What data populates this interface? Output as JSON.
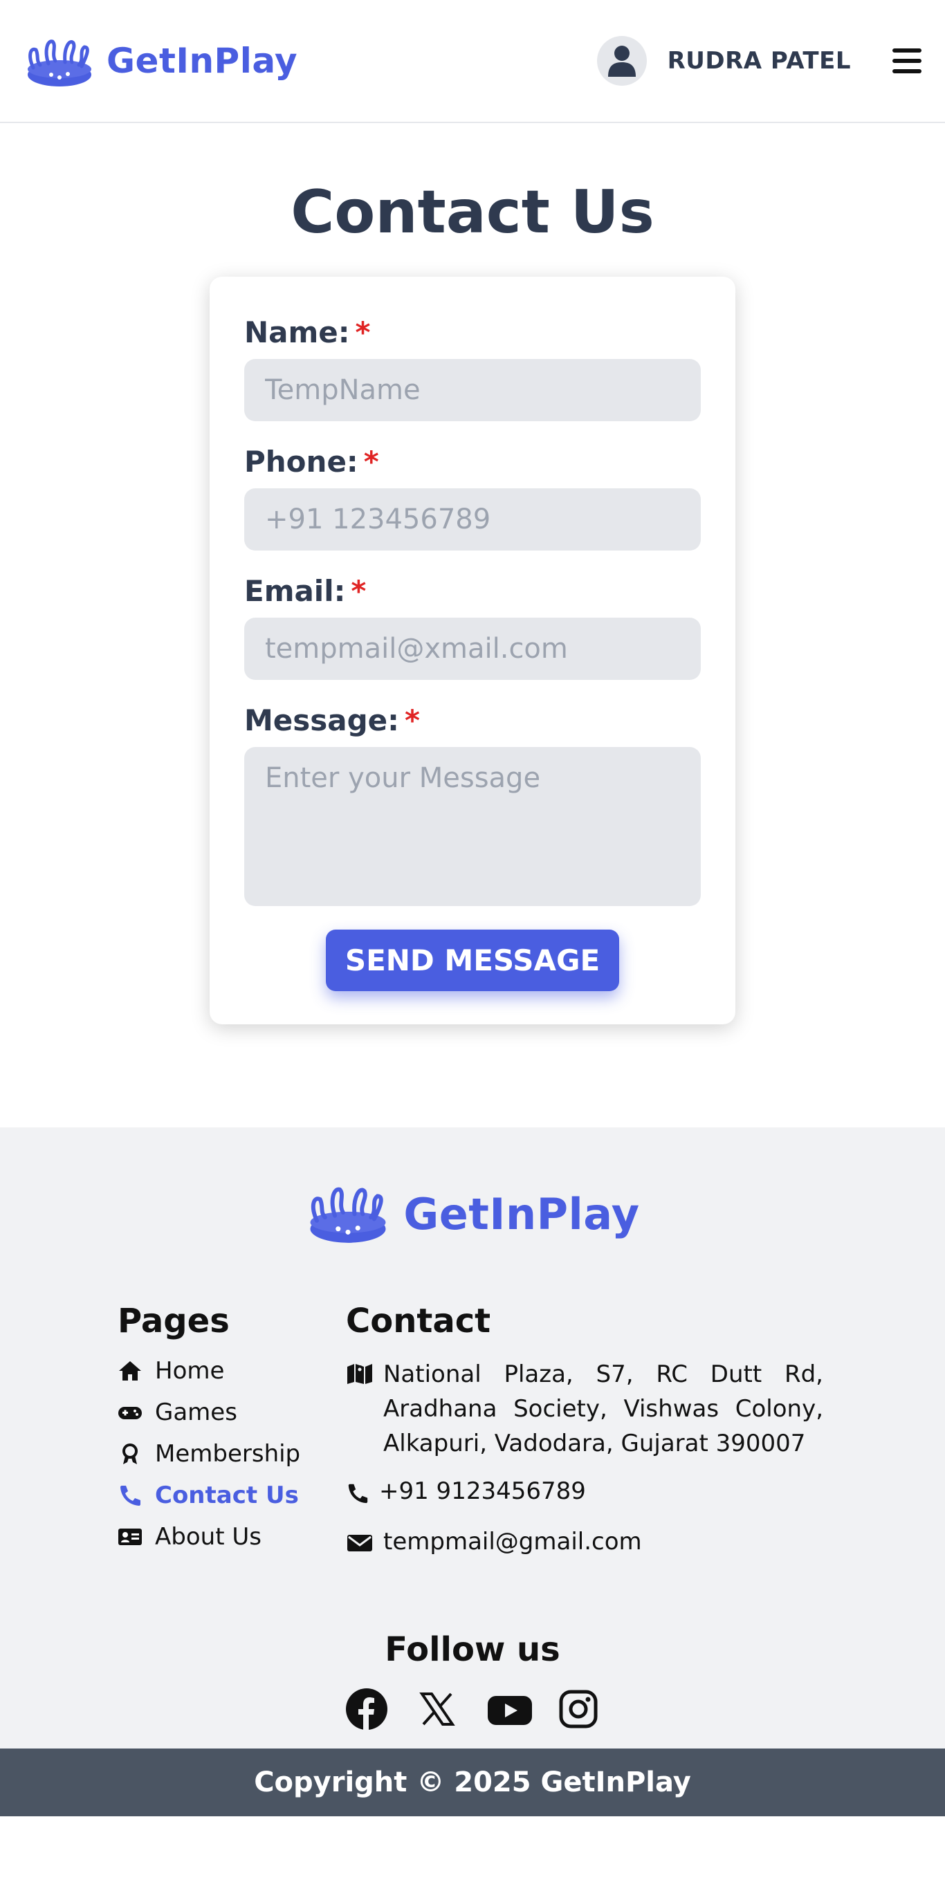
{
  "header": {
    "brand_name": "GetInPlay",
    "user_name": "RUDRA PATEL",
    "brand_color": "#4a5ee0"
  },
  "main": {
    "title": "Contact Us",
    "form": {
      "name_label": "Name:",
      "name_placeholder": "TempName",
      "phone_label": "Phone:",
      "phone_placeholder": "+91 123456789",
      "email_label": "Email:",
      "email_placeholder": "tempmail@xmail.com",
      "message_label": "Message:",
      "message_placeholder": "Enter your Message",
      "required_mark": "*",
      "submit_label": "SEND MESSAGE"
    }
  },
  "footer": {
    "brand_name": "GetInPlay",
    "pages_title": "Pages",
    "pages": [
      {
        "label": "Home",
        "icon": "home-icon"
      },
      {
        "label": "Games",
        "icon": "gamepad-icon"
      },
      {
        "label": "Membership",
        "icon": "award-icon"
      },
      {
        "label": "Contact Us",
        "icon": "phone-icon",
        "active": true
      },
      {
        "label": "About Us",
        "icon": "id-card-icon"
      }
    ],
    "contact_title": "Contact",
    "address": "National Plaza, S7, RC Dutt Rd, Aradhana Society, Vishwas Colony, Alkapuri, Vadodara, Gujarat 390007",
    "phone": "+91 9123456789",
    "email": "tempmail@gmail.com",
    "follow_title": "Follow us",
    "socials": [
      "facebook-icon",
      "x-icon",
      "youtube-icon",
      "instagram-icon"
    ],
    "copyright": "Copyright © 2025 GetInPlay"
  }
}
